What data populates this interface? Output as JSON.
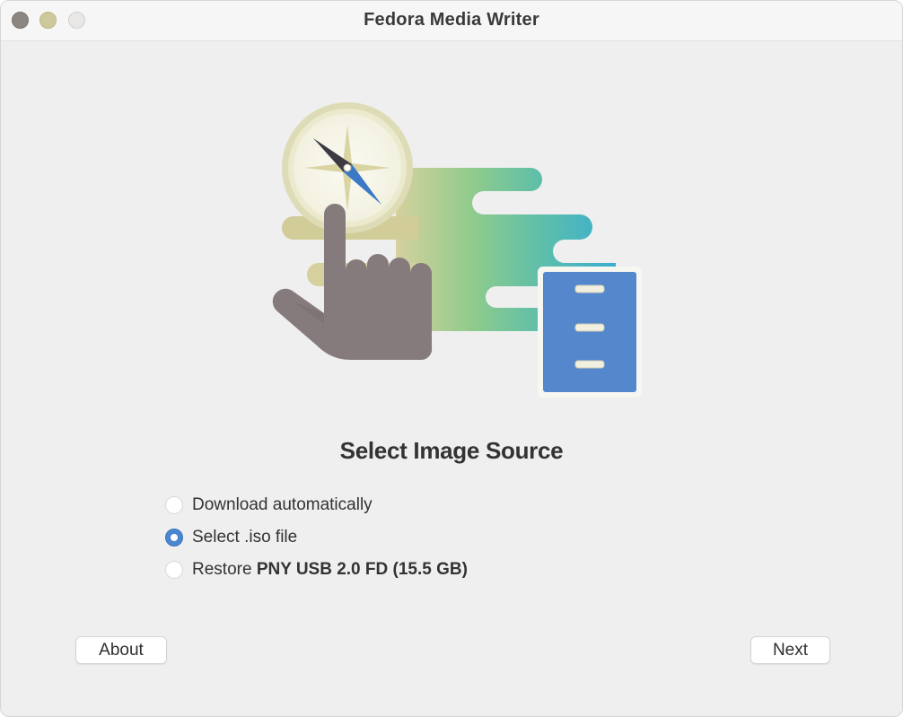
{
  "window": {
    "title": "Fedora Media Writer"
  },
  "illustration": {
    "icons": [
      "compass-icon",
      "pointing-hand-icon",
      "usb-drive-icon"
    ],
    "colors": {
      "compass_ring": "#e7e5c6",
      "compass_needle_dark": "#3c3c44",
      "compass_needle_blue": "#3a78c8",
      "hand": "#857b7c",
      "gradient_start": "#d2cd98",
      "gradient_mid": "#7dc98f",
      "gradient_end": "#3fb1cf",
      "drive": "#5487cb"
    }
  },
  "main": {
    "heading": "Select Image Source",
    "options": [
      {
        "label": "Download automatically",
        "selected": false
      },
      {
        "label": "Select .iso file",
        "selected": true
      },
      {
        "label_prefix": "Restore ",
        "label_bold": "PNY USB 2.0 FD (15.5 GB)",
        "selected": false
      }
    ]
  },
  "footer": {
    "about_label": "About",
    "next_label": "Next"
  },
  "colors": {
    "accent": "#4a86cf",
    "window_bg": "#efefef"
  }
}
